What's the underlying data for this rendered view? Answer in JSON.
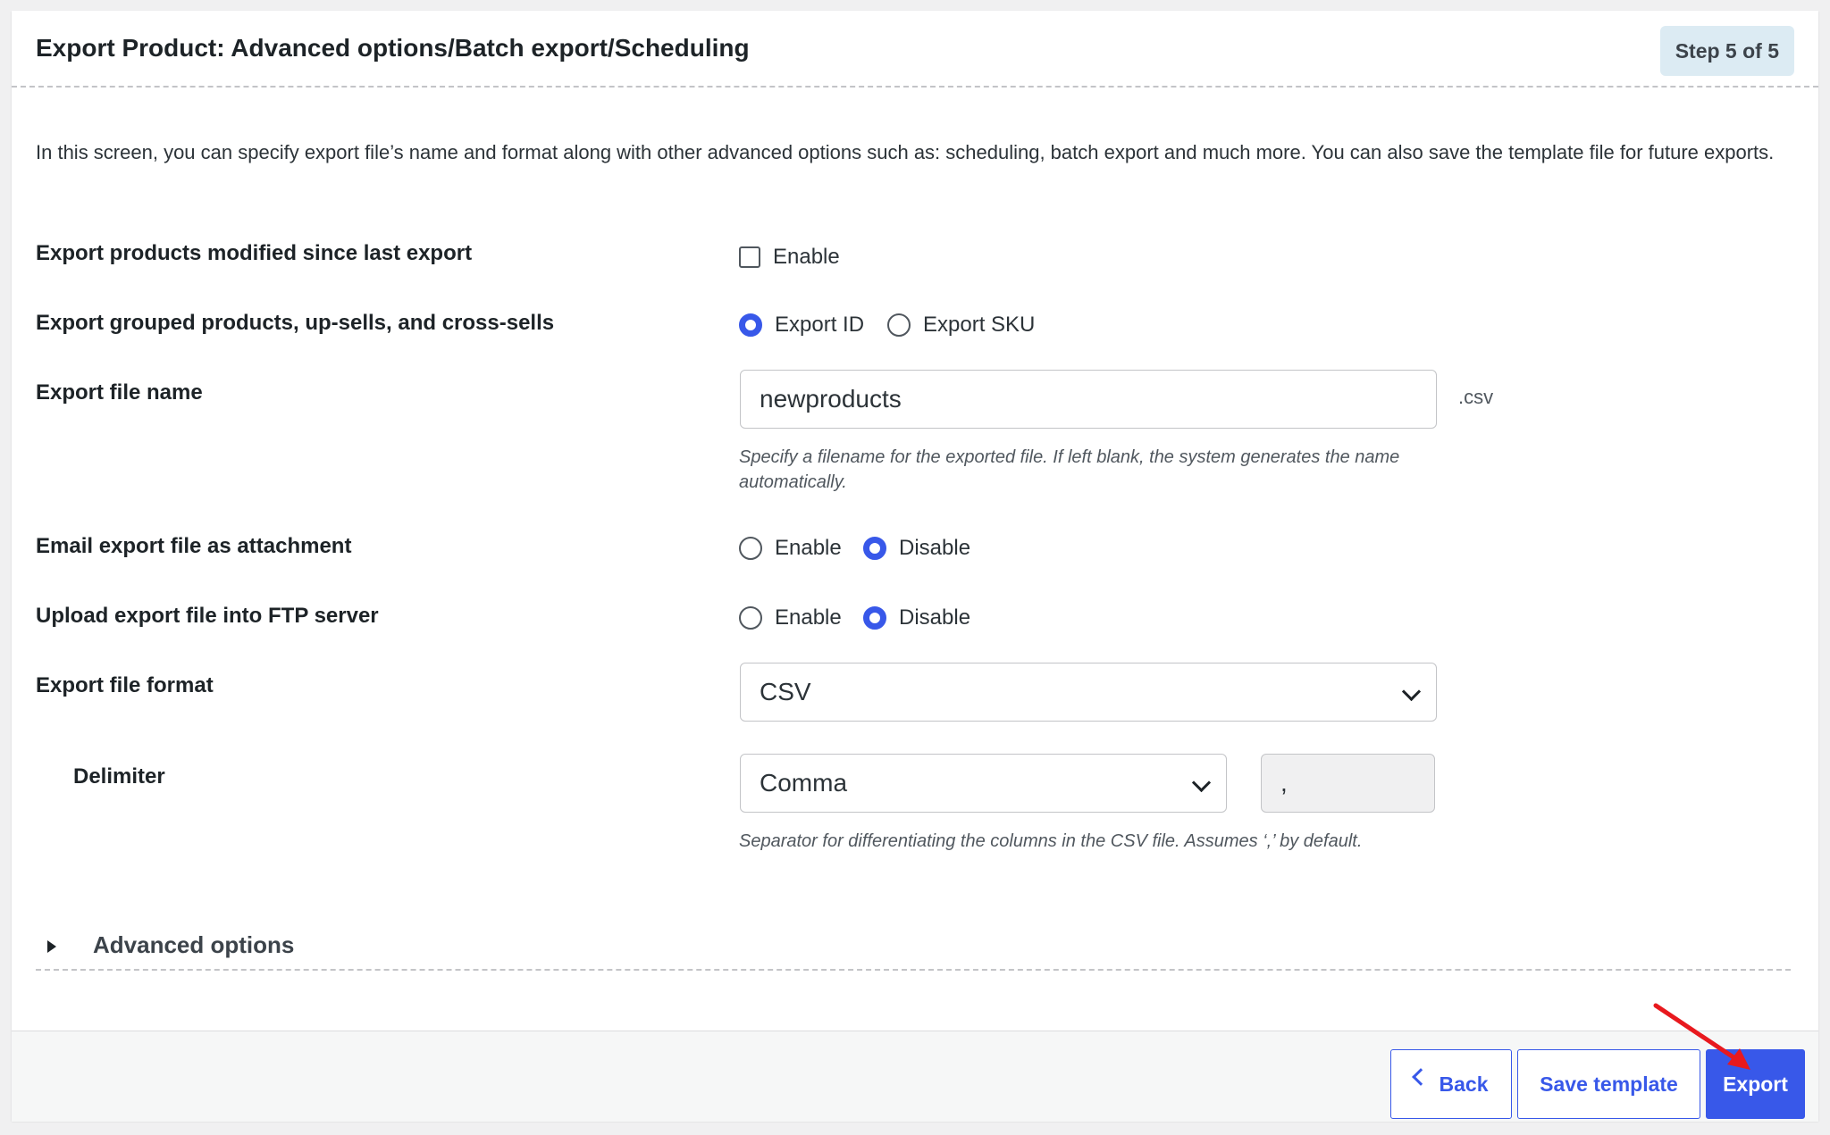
{
  "header": {
    "title": "Export Product: Advanced options/Batch export/Scheduling",
    "step": "Step 5 of 5"
  },
  "intro": "In this screen, you can specify export file’s name and format along with other advanced options such as: scheduling, batch export and much more. You can also save the template file for future exports.",
  "fields": {
    "modified_since": {
      "label": "Export products modified since last export",
      "option": "Enable",
      "checked": false
    },
    "grouped": {
      "label": "Export grouped products, up-sells, and cross-sells",
      "options": [
        "Export ID",
        "Export SKU"
      ],
      "selected": "Export ID"
    },
    "file_name": {
      "label": "Export file name",
      "value": "newproducts",
      "suffix": ".csv",
      "hint": "Specify a filename for the exported file. If left blank, the system generates the name automatically."
    },
    "email": {
      "label": "Email export file as attachment",
      "options": [
        "Enable",
        "Disable"
      ],
      "selected": "Disable"
    },
    "ftp": {
      "label": "Upload export file into FTP server",
      "options": [
        "Enable",
        "Disable"
      ],
      "selected": "Disable"
    },
    "format": {
      "label": "Export file format",
      "value": "CSV"
    },
    "delimiter": {
      "label": "Delimiter",
      "value": "Comma",
      "char": ",",
      "hint": "Separator for differentiating the columns in the CSV file. Assumes ‘,’ by default."
    }
  },
  "advanced": {
    "label": "Advanced options"
  },
  "footer": {
    "back": "Back",
    "save": "Save template",
    "export": "Export"
  },
  "colors": {
    "accent": "#3858e9",
    "annotation_arrow": "#e8191e",
    "step_badge_bg": "#dcebf3"
  },
  "icons": {
    "advanced_toggle": "caret-right-icon",
    "back": "chevron-left-icon",
    "select": "chevron-down-icon",
    "annotation": "red-arrow-icon"
  }
}
